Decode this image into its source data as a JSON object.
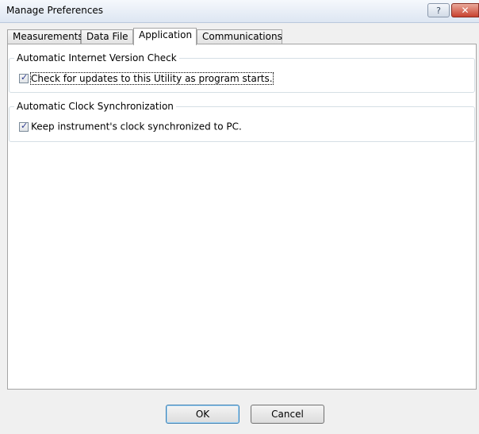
{
  "window": {
    "title": "Manage Preferences",
    "help_label": "?",
    "close_label": "✕"
  },
  "tabs": [
    {
      "label": "Measurements",
      "selected": false
    },
    {
      "label": "Data File",
      "selected": false
    },
    {
      "label": "Application",
      "selected": true
    },
    {
      "label": "Communications",
      "selected": false
    }
  ],
  "groups": {
    "version_check": {
      "title": "Automatic Internet Version Check",
      "option_label": "Check for updates to this Utility as program starts.",
      "checked": true
    },
    "clock_sync": {
      "title": "Automatic Clock Synchronization",
      "option_label": "Keep instrument's clock synchronized to PC.",
      "checked": true
    }
  },
  "buttons": {
    "ok": "OK",
    "cancel": "Cancel"
  }
}
